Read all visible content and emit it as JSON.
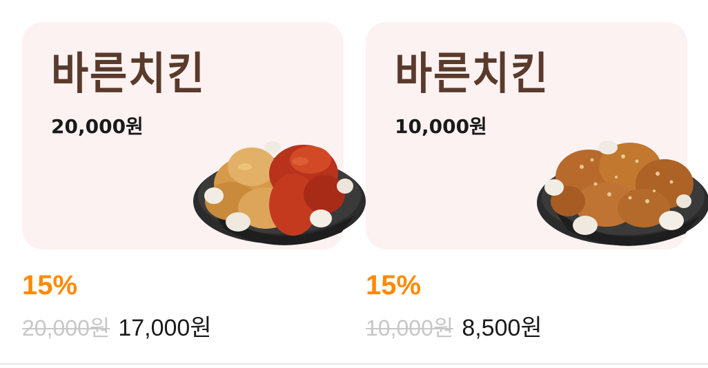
{
  "products": [
    {
      "brand": "바른치킨",
      "card_price": "20,000원",
      "discount": "15%",
      "original_price": "20,000원",
      "sale_price": "17,000원"
    },
    {
      "brand": "바른치킨",
      "card_price": "10,000원",
      "discount": "15%",
      "original_price": "10,000원",
      "sale_price": "8,500원"
    }
  ],
  "colors": {
    "card_bg": "#fcf2f1",
    "brand_text": "#5a3a2b",
    "discount": "#ff8a00",
    "strikethrough_price": "#c7c7c7"
  }
}
